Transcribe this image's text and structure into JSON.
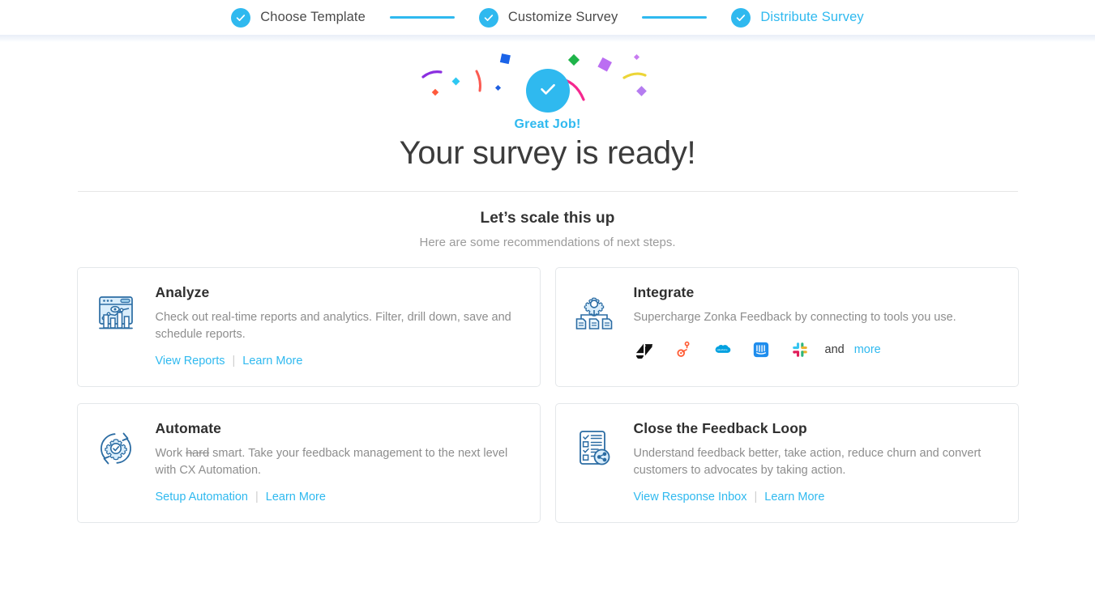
{
  "theme": {
    "accent": "#2fb9ef",
    "title_color": "#3c3c3c",
    "muted_color": "#8d8d8d",
    "card_border": "#e4e7ea"
  },
  "stepper": {
    "steps": [
      {
        "label": "Choose Template",
        "state": "complete",
        "icon": "check-circle-icon"
      },
      {
        "label": "Customize Survey",
        "state": "complete",
        "icon": "check-circle-icon"
      },
      {
        "label": "Distribute Survey",
        "state": "active",
        "icon": "check-circle-icon"
      }
    ]
  },
  "hero": {
    "badge_icon": "check-circle-icon",
    "eyebrow": "Great Job!",
    "title": "Your survey is ready!"
  },
  "section": {
    "title": "Let’s scale this up",
    "subtitle": "Here are some recommendations of next steps."
  },
  "cards": [
    {
      "id": "analyze",
      "icon": "analytics-dashboard-icon",
      "title": "Analyze",
      "description": "Check out real-time reports and analytics. Filter, drill down, save and schedule reports.",
      "links": [
        {
          "label": "View Reports"
        },
        {
          "label": "Learn More"
        }
      ]
    },
    {
      "id": "integrate",
      "icon": "gear-documents-icon",
      "title": "Integrate",
      "description": "Supercharge Zonka Feedback by connecting to tools you use.",
      "integrations": [
        {
          "name": "zendesk-logo"
        },
        {
          "name": "hubspot-logo"
        },
        {
          "name": "salesforce-logo"
        },
        {
          "name": "intercom-logo"
        },
        {
          "name": "slack-logo"
        }
      ],
      "integrations_and": "and",
      "integrations_more": "more",
      "links": []
    },
    {
      "id": "automate",
      "icon": "gear-refresh-check-icon",
      "title": "Automate",
      "description_pre": "Work ",
      "description_strike": "hard",
      "description_post": " smart. Take your feedback management to the next level with CX Automation.",
      "links": [
        {
          "label": "Setup Automation"
        },
        {
          "label": "Learn More"
        }
      ]
    },
    {
      "id": "close-feedback-loop",
      "icon": "checklist-share-icon",
      "title": "Close the Feedback Loop",
      "description": "Understand feedback better, take action, reduce churn and convert customers to advocates by taking action.",
      "links": [
        {
          "label": "View Response Inbox"
        },
        {
          "label": "Learn More"
        }
      ]
    }
  ]
}
